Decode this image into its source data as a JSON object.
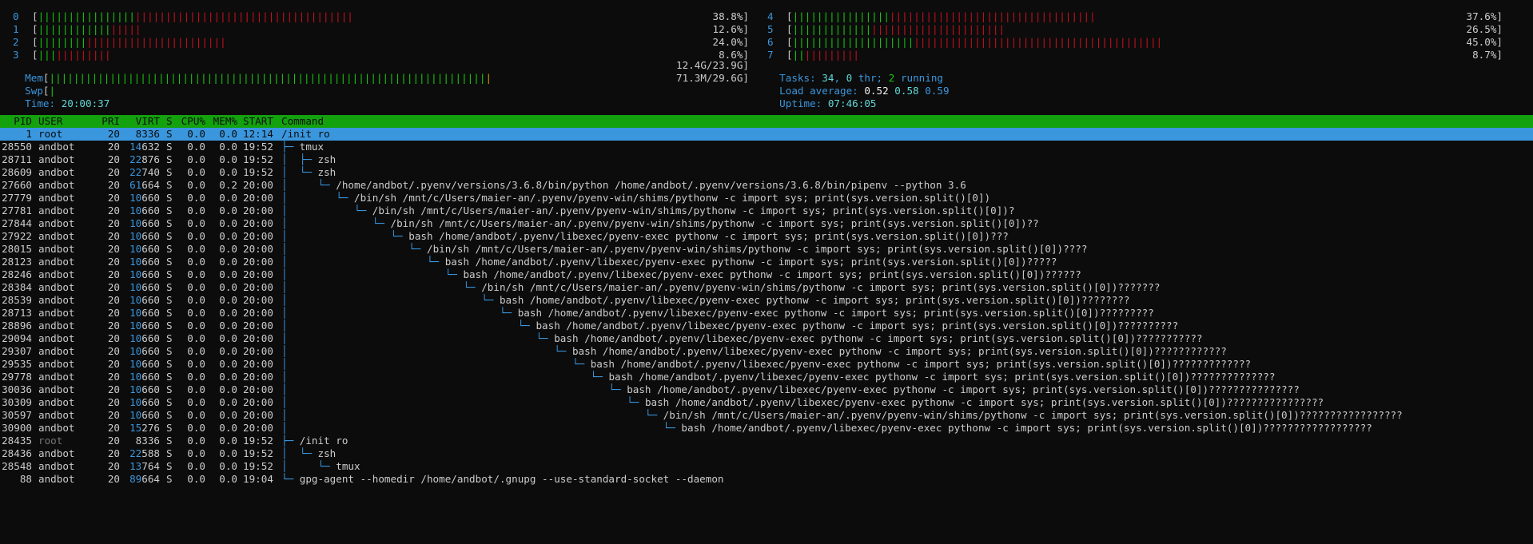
{
  "cpus_left": [
    {
      "id": "0",
      "green": 16,
      "red": 36,
      "value": "38.8%]"
    },
    {
      "id": "1",
      "green": 12,
      "red": 5,
      "value": "12.6%]"
    },
    {
      "id": "2",
      "green": 8,
      "red": 23,
      "value": "24.0%]"
    },
    {
      "id": "3",
      "green": 3,
      "red": 9,
      "value": "8.6%]"
    }
  ],
  "cpus_right": [
    {
      "id": "4",
      "green": 16,
      "red": 34,
      "value": "37.6%]"
    },
    {
      "id": "5",
      "green": 13,
      "red": 22,
      "value": "26.5%]"
    },
    {
      "id": "6",
      "green": 20,
      "red": 41,
      "value": "45.0%]"
    },
    {
      "id": "7",
      "green": 2,
      "red": 9,
      "value": "8.7%]"
    }
  ],
  "mem": {
    "label": "Mem",
    "green": 72,
    "blue": 0,
    "yellow": 1,
    "value": "12.4G/23.9G]"
  },
  "swp": {
    "label": "Swp",
    "green": 1,
    "value": "71.3M/29.6G]"
  },
  "time": {
    "label": "Time:",
    "value": "20:00:37"
  },
  "tasks": {
    "label": "Tasks:",
    "count": "34",
    "sep1": ",",
    "thr": "0",
    "thr_label": "thr;",
    "running": "2",
    "running_label": "running"
  },
  "load": {
    "label": "Load average:",
    "v1": "0.52",
    "v5": "0.58",
    "v15": "0.59"
  },
  "uptime": {
    "label": "Uptime:",
    "value": "07:46:05"
  },
  "columns": {
    "pid": "PID",
    "user": "USER",
    "pri": "PRI",
    "virt": "VIRT",
    "s": "S",
    "cpu": "CPU%",
    "mem": "MEM%",
    "start": "START",
    "command": "Command"
  },
  "processes": [
    {
      "pid": "1",
      "user": "root",
      "pri": "20",
      "virt_k": "",
      "virt_r": "8336",
      "s": "S",
      "cpu": "0.0",
      "mem": "0.0",
      "start": "12:14",
      "tree": "",
      "command": "/init ro",
      "selected": true
    },
    {
      "pid": "28550",
      "user": "andbot",
      "pri": "20",
      "virt_k": "14",
      "virt_r": "632",
      "s": "S",
      "cpu": "0.0",
      "mem": "0.0",
      "start": "19:52",
      "tree": "├─ ",
      "command": "tmux"
    },
    {
      "pid": "28711",
      "user": "andbot",
      "pri": "20",
      "virt_k": "22",
      "virt_r": "876",
      "s": "S",
      "cpu": "0.0",
      "mem": "0.0",
      "start": "19:52",
      "tree": "│  ├─ ",
      "command": "zsh"
    },
    {
      "pid": "28609",
      "user": "andbot",
      "pri": "20",
      "virt_k": "22",
      "virt_r": "740",
      "s": "S",
      "cpu": "0.0",
      "mem": "0.0",
      "start": "19:52",
      "tree": "│  └─ ",
      "command": "zsh"
    },
    {
      "pid": "27660",
      "user": "andbot",
      "pri": "20",
      "virt_k": "61",
      "virt_r": "664",
      "s": "S",
      "cpu": "0.0",
      "mem": "0.2",
      "start": "20:00",
      "tree": "│     └─ ",
      "command": "/home/andbot/.pyenv/versions/3.6.8/bin/python /home/andbot/.pyenv/versions/3.6.8/bin/pipenv --python 3.6"
    },
    {
      "pid": "27779",
      "user": "andbot",
      "pri": "20",
      "virt_k": "10",
      "virt_r": "660",
      "s": "S",
      "cpu": "0.0",
      "mem": "0.0",
      "start": "20:00",
      "tree": "│        └─ ",
      "command": "/bin/sh /mnt/c/Users/maier-an/.pyenv/pyenv-win/shims/pythonw -c import sys; print(sys.version.split()[0])"
    },
    {
      "pid": "27781",
      "user": "andbot",
      "pri": "20",
      "virt_k": "10",
      "virt_r": "660",
      "s": "S",
      "cpu": "0.0",
      "mem": "0.0",
      "start": "20:00",
      "tree": "│           └─ ",
      "command": "/bin/sh /mnt/c/Users/maier-an/.pyenv/pyenv-win/shims/pythonw -c import sys; print(sys.version.split()[0])?"
    },
    {
      "pid": "27844",
      "user": "andbot",
      "pri": "20",
      "virt_k": "10",
      "virt_r": "660",
      "s": "S",
      "cpu": "0.0",
      "mem": "0.0",
      "start": "20:00",
      "tree": "│              └─ ",
      "command": "/bin/sh /mnt/c/Users/maier-an/.pyenv/pyenv-win/shims/pythonw -c import sys; print(sys.version.split()[0])??"
    },
    {
      "pid": "27922",
      "user": "andbot",
      "pri": "20",
      "virt_k": "10",
      "virt_r": "660",
      "s": "S",
      "cpu": "0.0",
      "mem": "0.0",
      "start": "20:00",
      "tree": "│                 └─ ",
      "command": "bash /home/andbot/.pyenv/libexec/pyenv-exec pythonw -c import sys; print(sys.version.split()[0])???"
    },
    {
      "pid": "28015",
      "user": "andbot",
      "pri": "20",
      "virt_k": "10",
      "virt_r": "660",
      "s": "S",
      "cpu": "0.0",
      "mem": "0.0",
      "start": "20:00",
      "tree": "│                    └─ ",
      "command": "/bin/sh /mnt/c/Users/maier-an/.pyenv/pyenv-win/shims/pythonw -c import sys; print(sys.version.split()[0])????"
    },
    {
      "pid": "28123",
      "user": "andbot",
      "pri": "20",
      "virt_k": "10",
      "virt_r": "660",
      "s": "S",
      "cpu": "0.0",
      "mem": "0.0",
      "start": "20:00",
      "tree": "│                       └─ ",
      "command": "bash /home/andbot/.pyenv/libexec/pyenv-exec pythonw -c import sys; print(sys.version.split()[0])?????"
    },
    {
      "pid": "28246",
      "user": "andbot",
      "pri": "20",
      "virt_k": "10",
      "virt_r": "660",
      "s": "S",
      "cpu": "0.0",
      "mem": "0.0",
      "start": "20:00",
      "tree": "│                          └─ ",
      "command": "bash /home/andbot/.pyenv/libexec/pyenv-exec pythonw -c import sys; print(sys.version.split()[0])??????"
    },
    {
      "pid": "28384",
      "user": "andbot",
      "pri": "20",
      "virt_k": "10",
      "virt_r": "660",
      "s": "S",
      "cpu": "0.0",
      "mem": "0.0",
      "start": "20:00",
      "tree": "│                             └─ ",
      "command": "/bin/sh /mnt/c/Users/maier-an/.pyenv/pyenv-win/shims/pythonw -c import sys; print(sys.version.split()[0])???????"
    },
    {
      "pid": "28539",
      "user": "andbot",
      "pri": "20",
      "virt_k": "10",
      "virt_r": "660",
      "s": "S",
      "cpu": "0.0",
      "mem": "0.0",
      "start": "20:00",
      "tree": "│                                └─ ",
      "command": "bash /home/andbot/.pyenv/libexec/pyenv-exec pythonw -c import sys; print(sys.version.split()[0])????????"
    },
    {
      "pid": "28713",
      "user": "andbot",
      "pri": "20",
      "virt_k": "10",
      "virt_r": "660",
      "s": "S",
      "cpu": "0.0",
      "mem": "0.0",
      "start": "20:00",
      "tree": "│                                   └─ ",
      "command": "bash /home/andbot/.pyenv/libexec/pyenv-exec pythonw -c import sys; print(sys.version.split()[0])?????????"
    },
    {
      "pid": "28896",
      "user": "andbot",
      "pri": "20",
      "virt_k": "10",
      "virt_r": "660",
      "s": "S",
      "cpu": "0.0",
      "mem": "0.0",
      "start": "20:00",
      "tree": "│                                      └─ ",
      "command": "bash /home/andbot/.pyenv/libexec/pyenv-exec pythonw -c import sys; print(sys.version.split()[0])??????????"
    },
    {
      "pid": "29094",
      "user": "andbot",
      "pri": "20",
      "virt_k": "10",
      "virt_r": "660",
      "s": "S",
      "cpu": "0.0",
      "mem": "0.0",
      "start": "20:00",
      "tree": "│                                         └─ ",
      "command": "bash /home/andbot/.pyenv/libexec/pyenv-exec pythonw -c import sys; print(sys.version.split()[0])???????????"
    },
    {
      "pid": "29307",
      "user": "andbot",
      "pri": "20",
      "virt_k": "10",
      "virt_r": "660",
      "s": "S",
      "cpu": "0.0",
      "mem": "0.0",
      "start": "20:00",
      "tree": "│                                            └─ ",
      "command": "bash /home/andbot/.pyenv/libexec/pyenv-exec pythonw -c import sys; print(sys.version.split()[0])????????????"
    },
    {
      "pid": "29535",
      "user": "andbot",
      "pri": "20",
      "virt_k": "10",
      "virt_r": "660",
      "s": "S",
      "cpu": "0.0",
      "mem": "0.0",
      "start": "20:00",
      "tree": "│                                               └─ ",
      "command": "bash /home/andbot/.pyenv/libexec/pyenv-exec pythonw -c import sys; print(sys.version.split()[0])?????????????"
    },
    {
      "pid": "29778",
      "user": "andbot",
      "pri": "20",
      "virt_k": "10",
      "virt_r": "660",
      "s": "S",
      "cpu": "0.0",
      "mem": "0.0",
      "start": "20:00",
      "tree": "│                                                  └─ ",
      "command": "bash /home/andbot/.pyenv/libexec/pyenv-exec pythonw -c import sys; print(sys.version.split()[0])??????????????"
    },
    {
      "pid": "30036",
      "user": "andbot",
      "pri": "20",
      "virt_k": "10",
      "virt_r": "660",
      "s": "S",
      "cpu": "0.0",
      "mem": "0.0",
      "start": "20:00",
      "tree": "│                                                     └─ ",
      "command": "bash /home/andbot/.pyenv/libexec/pyenv-exec pythonw -c import sys; print(sys.version.split()[0])???????????????"
    },
    {
      "pid": "30309",
      "user": "andbot",
      "pri": "20",
      "virt_k": "10",
      "virt_r": "660",
      "s": "S",
      "cpu": "0.0",
      "mem": "0.0",
      "start": "20:00",
      "tree": "│                                                        └─ ",
      "command": "bash /home/andbot/.pyenv/libexec/pyenv-exec pythonw -c import sys; print(sys.version.split()[0])????????????????"
    },
    {
      "pid": "30597",
      "user": "andbot",
      "pri": "20",
      "virt_k": "10",
      "virt_r": "660",
      "s": "S",
      "cpu": "0.0",
      "mem": "0.0",
      "start": "20:00",
      "tree": "│                                                           └─ ",
      "command": "/bin/sh /mnt/c/Users/maier-an/.pyenv/pyenv-win/shims/pythonw -c import sys; print(sys.version.split()[0])?????????????????"
    },
    {
      "pid": "30900",
      "user": "andbot",
      "pri": "20",
      "virt_k": "15",
      "virt_r": "276",
      "s": "S",
      "cpu": "0.0",
      "mem": "0.0",
      "start": "20:00",
      "tree": "│                                                              └─ ",
      "command": "bash /home/andbot/.pyenv/libexec/pyenv-exec pythonw -c import sys; print(sys.version.split()[0])??????????????????"
    },
    {
      "pid": "28435",
      "user": "root",
      "pri": "20",
      "virt_k": "",
      "virt_r": "8336",
      "s": "S",
      "cpu": "0.0",
      "mem": "0.0",
      "start": "19:52",
      "tree": "├─ ",
      "command": "/init ro",
      "dimuser": true
    },
    {
      "pid": "28436",
      "user": "andbot",
      "pri": "20",
      "virt_k": "22",
      "virt_r": "588",
      "s": "S",
      "cpu": "0.0",
      "mem": "0.0",
      "start": "19:52",
      "tree": "│  └─ ",
      "command": "zsh"
    },
    {
      "pid": "28548",
      "user": "andbot",
      "pri": "20",
      "virt_k": "13",
      "virt_r": "764",
      "s": "S",
      "cpu": "0.0",
      "mem": "0.0",
      "start": "19:52",
      "tree": "│     └─ ",
      "command": "tmux"
    },
    {
      "pid": "88",
      "user": "andbot",
      "pri": "20",
      "virt_k": "89",
      "virt_r": "664",
      "s": "S",
      "cpu": "0.0",
      "mem": "0.0",
      "start": "19:04",
      "tree": "└─ ",
      "command": "gpg-agent --homedir /home/andbot/.gnupg --use-standard-socket --daemon"
    }
  ]
}
